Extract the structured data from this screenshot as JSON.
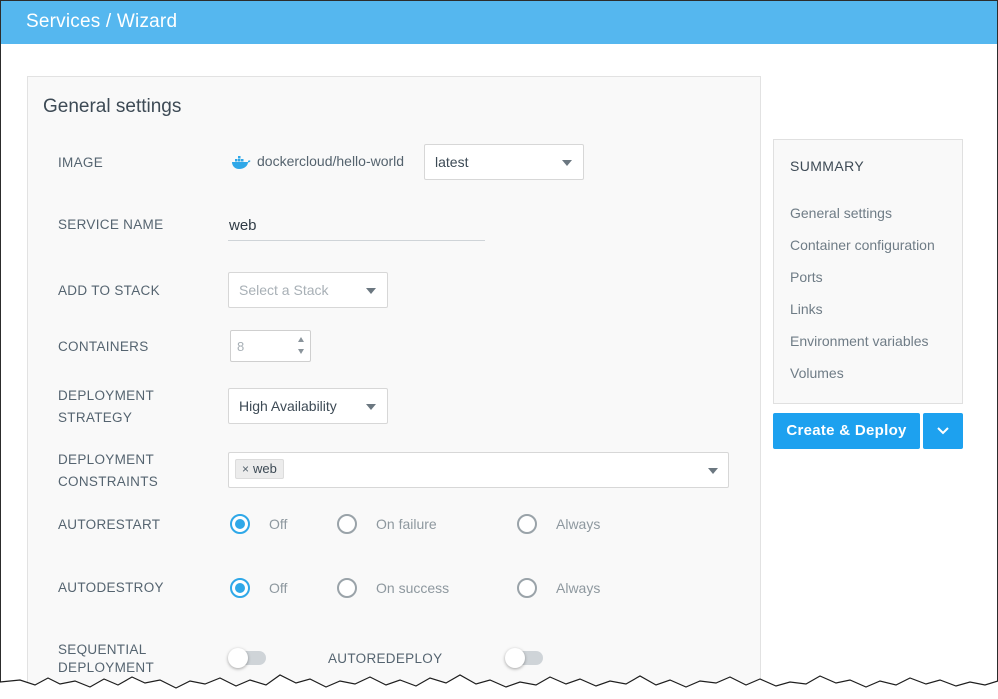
{
  "header": {
    "title": "Services / Wizard"
  },
  "general": {
    "title": "General settings",
    "image": {
      "label": "IMAGE",
      "name": "dockercloud/hello-world",
      "tag": "latest",
      "icon": "docker-whale-icon"
    },
    "service_name": {
      "label": "SERVICE NAME",
      "value": "web"
    },
    "stack": {
      "label": "ADD TO STACK",
      "placeholder": "Select a Stack"
    },
    "containers": {
      "label": "CONTAINERS",
      "value": "8"
    },
    "strategy": {
      "label_line1": "DEPLOYMENT",
      "label_line2": "STRATEGY",
      "value": "High Availability"
    },
    "constraints": {
      "label_line1": "DEPLOYMENT",
      "label_line2": "CONSTRAINTS",
      "tag_remove": "×",
      "tag": "web"
    },
    "autorestart": {
      "label": "AUTORESTART",
      "options": [
        "Off",
        "On failure",
        "Always"
      ],
      "selected": "Off"
    },
    "autodestroy": {
      "label": "AUTODESTROY",
      "options": [
        "Off",
        "On success",
        "Always"
      ],
      "selected": "Off"
    },
    "sequential": {
      "label_line1": "SEQUENTIAL",
      "label_line2": "DEPLOYMENT",
      "enabled": false
    },
    "autoredeploy": {
      "label": "AUTOREDEPLOY",
      "enabled": false
    }
  },
  "summary": {
    "title": "SUMMARY",
    "items": [
      "General settings",
      "Container configuration",
      "Ports",
      "Links",
      "Environment variables",
      "Volumes"
    ]
  },
  "actions": {
    "deploy_label": "Create & Deploy"
  },
  "colors": {
    "accent": "#1da1ef",
    "header": "#55b7ef"
  }
}
